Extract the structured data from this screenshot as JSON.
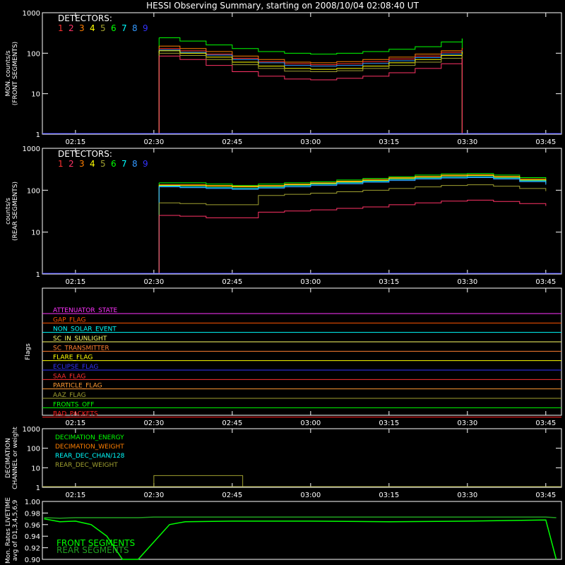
{
  "title": "HESSI Observing Summary, starting on 2008/10/04 02:08:40 UT",
  "time_ticks": [
    "02:15",
    "02:30",
    "02:45",
    "03:00",
    "03:15",
    "03:30",
    "03:45"
  ],
  "colors": {
    "axis": "#ffffff",
    "det": [
      "#ff3030",
      "#ff3366",
      "#ff7f00",
      "#ffff00",
      "#a0a030",
      "#00ff00",
      "#00ffff",
      "#3399ff",
      "#3333ff"
    ]
  },
  "detectors": {
    "label": "DETECTORS:",
    "numbers": [
      "1",
      "2",
      "3",
      "4",
      "5",
      "6",
      "7",
      "8",
      "9"
    ]
  },
  "chart_data": [
    {
      "type": "line",
      "name": "front",
      "ylabel": [
        "MON. counts/s",
        "(FRONT SEGMENTS)"
      ],
      "yscale": "log",
      "ylim": [
        1,
        1000
      ],
      "yticks": [
        "1",
        "10",
        "100",
        "1000"
      ],
      "x": [
        "02:31",
        "02:35",
        "02:40",
        "02:45",
        "02:50",
        "02:55",
        "03:00",
        "03:05",
        "03:10",
        "03:15",
        "03:20",
        "03:25",
        "03:29"
      ],
      "series": [
        {
          "color": "#00ff00",
          "values": [
            240,
            200,
            160,
            130,
            110,
            100,
            95,
            100,
            110,
            125,
            145,
            190,
            230
          ]
        },
        {
          "color": "#ff7f00",
          "values": [
            150,
            130,
            110,
            85,
            70,
            60,
            58,
            62,
            70,
            80,
            95,
            115,
            135
          ]
        },
        {
          "color": "#ff3030",
          "values": [
            130,
            115,
            95,
            75,
            62,
            55,
            52,
            55,
            62,
            72,
            85,
            105,
            125
          ]
        },
        {
          "color": "#3399ff",
          "values": [
            120,
            105,
            90,
            70,
            58,
            50,
            48,
            50,
            56,
            65,
            78,
            95,
            115
          ]
        },
        {
          "color": "#ffff00",
          "values": [
            115,
            100,
            80,
            60,
            48,
            42,
            40,
            42,
            48,
            58,
            70,
            88,
            108
          ]
        },
        {
          "color": "#a0a030",
          "values": [
            100,
            88,
            70,
            52,
            42,
            36,
            35,
            37,
            42,
            50,
            60,
            75,
            95
          ]
        },
        {
          "color": "#ff3366",
          "values": [
            85,
            70,
            50,
            35,
            27,
            23,
            22,
            24,
            27,
            33,
            42,
            55,
            75
          ]
        }
      ]
    },
    {
      "type": "line",
      "name": "rear",
      "ylabel": [
        "counts/s",
        "(REAR SEGMENTS)"
      ],
      "yscale": "log",
      "ylim": [
        1,
        1000
      ],
      "yticks": [
        "1",
        "10",
        "100",
        "1000"
      ],
      "x": [
        "02:31",
        "02:35",
        "02:40",
        "02:45",
        "02:50",
        "02:55",
        "03:00",
        "03:05",
        "03:10",
        "03:15",
        "03:20",
        "03:25",
        "03:30",
        "03:35",
        "03:40",
        "03:45"
      ],
      "series": [
        {
          "color": "#00ff00",
          "values": [
            150,
            150,
            140,
            130,
            140,
            150,
            160,
            175,
            190,
            210,
            230,
            245,
            250,
            230,
            200,
            170
          ]
        },
        {
          "color": "#ff7f00",
          "values": [
            135,
            135,
            130,
            125,
            130,
            140,
            150,
            165,
            180,
            200,
            215,
            230,
            235,
            215,
            185,
            155
          ]
        },
        {
          "color": "#ffff00",
          "values": [
            130,
            130,
            125,
            120,
            125,
            135,
            145,
            158,
            172,
            190,
            205,
            220,
            225,
            205,
            175,
            148
          ]
        },
        {
          "color": "#00ffff",
          "values": [
            125,
            120,
            115,
            110,
            118,
            128,
            138,
            150,
            163,
            180,
            195,
            205,
            210,
            195,
            168,
            140
          ]
        },
        {
          "color": "#3399ff",
          "values": [
            120,
            115,
            110,
            105,
            112,
            120,
            130,
            142,
            155,
            170,
            185,
            195,
            200,
            185,
            160,
            135
          ]
        },
        {
          "color": "#a0a030",
          "values": [
            50,
            48,
            45,
            45,
            75,
            80,
            85,
            92,
            100,
            110,
            120,
            130,
            135,
            125,
            110,
            95
          ]
        },
        {
          "color": "#ff3366",
          "values": [
            25,
            24,
            22,
            22,
            30,
            32,
            34,
            37,
            40,
            45,
            50,
            55,
            58,
            54,
            48,
            42
          ]
        }
      ]
    },
    {
      "type": "table",
      "name": "flags",
      "ylabel": "Flags",
      "flags": [
        {
          "label": "ATTENUATOR_STATE",
          "color": "#ff33ff"
        },
        {
          "label": "GAP_FLAG",
          "color": "#ff5500"
        },
        {
          "label": "NON_SOLAR_EVENT",
          "color": "#00ffff"
        },
        {
          "label": "SC_IN_SUNLIGHT",
          "color": "#ffff66"
        },
        {
          "label": "SC_TRANSMITTER",
          "color": "#ff7f30"
        },
        {
          "label": "FLARE_FLAG",
          "color": "#ffff00"
        },
        {
          "label": "ECLIPSE_FLAG",
          "color": "#3333ff"
        },
        {
          "label": "SAA_FLAG",
          "color": "#ff3030"
        },
        {
          "label": "PARTICLE_FLAG",
          "color": "#ff9933"
        },
        {
          "label": "AAZ_FLAG",
          "color": "#a0a030"
        },
        {
          "label": "FRONTS_OFF",
          "color": "#00ff00"
        },
        {
          "label": "BAD_PACKETS",
          "color": "#ff2020"
        }
      ]
    },
    {
      "type": "line",
      "name": "decimation",
      "ylabel": [
        "DECIMATION",
        "CHANNEL or weight"
      ],
      "yscale": "log",
      "ylim": [
        1,
        1000
      ],
      "yticks": [
        "1",
        "10",
        "100",
        "1000"
      ],
      "legend": [
        {
          "label": "DECIMATION_ENERGY",
          "color": "#00ff00"
        },
        {
          "label": "DECIMATION_WEIGHT",
          "color": "#ff7f00"
        },
        {
          "label": "REAR_DEC_CHAN/128",
          "color": "#00ffff"
        },
        {
          "label": "REAR_DEC_WEIGHT",
          "color": "#a0a030"
        }
      ],
      "segments": [
        {
          "series": "REAR_DEC_WEIGHT",
          "x_start": "02:30",
          "x_end": "02:47",
          "value": 4
        }
      ]
    },
    {
      "type": "line",
      "name": "livetime",
      "ylabel": [
        "Mon. Rates LIVETIME",
        "avg of D1,3,4,5,6,9"
      ],
      "ylim": [
        0.9,
        1.0
      ],
      "yticks": [
        "0.90",
        "0.92",
        "0.94",
        "0.96",
        "0.98",
        "1.00"
      ],
      "legend": [
        {
          "label": "FRONT SEGMENTS",
          "color": "#00ff00"
        },
        {
          "label": "REAR SEGMENTS",
          "color": "#20a020"
        }
      ],
      "x": [
        "02:09",
        "02:12",
        "02:15",
        "02:18",
        "02:21",
        "02:24",
        "02:27",
        "02:30",
        "02:33",
        "02:36",
        "02:45",
        "03:00",
        "03:15",
        "03:30",
        "03:45",
        "03:47"
      ],
      "series": [
        {
          "name": "FRONT SEGMENTS",
          "color": "#00ff00",
          "values": [
            0.97,
            0.965,
            0.966,
            0.96,
            0.94,
            0.9,
            0.9,
            0.93,
            0.96,
            0.965,
            0.966,
            0.966,
            0.965,
            0.966,
            0.968,
            0.9
          ]
        },
        {
          "name": "REAR SEGMENTS",
          "color": "#20a020",
          "values": [
            0.972,
            0.971,
            0.972,
            0.972,
            0.972,
            0.972,
            0.972,
            0.973,
            0.973,
            0.973,
            0.973,
            0.973,
            0.973,
            0.973,
            0.973,
            0.972
          ]
        }
      ]
    }
  ]
}
